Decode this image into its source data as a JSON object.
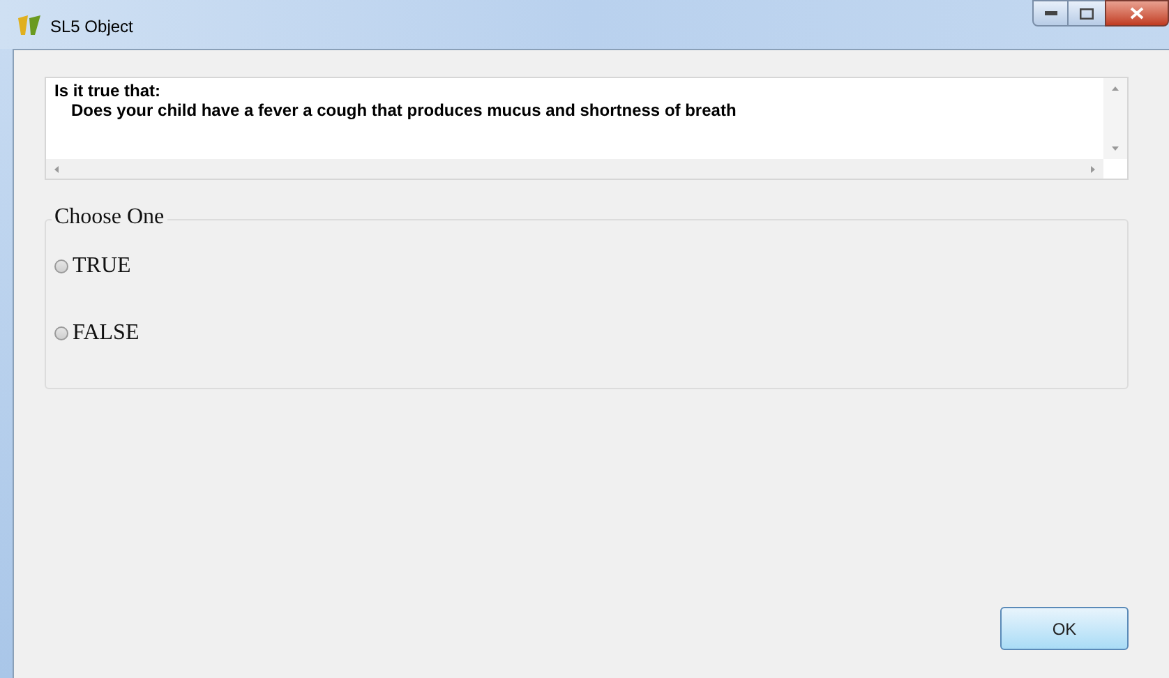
{
  "window": {
    "title": "SL5 Object"
  },
  "question": {
    "heading": "Is it true that:",
    "text": "Does your child have a fever a cough that produces mucus and shortness of breath"
  },
  "choice_group": {
    "label": "Choose One",
    "options": [
      {
        "label": "TRUE",
        "selected": false
      },
      {
        "label": "FALSE",
        "selected": false
      }
    ]
  },
  "buttons": [
    "OK"
  ]
}
